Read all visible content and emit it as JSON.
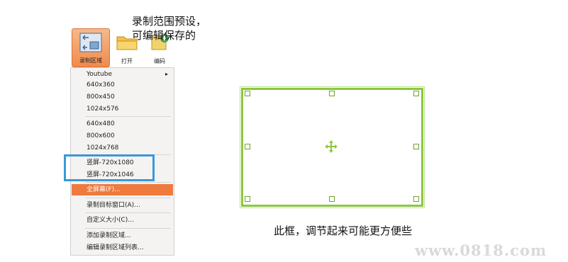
{
  "toolbar": {
    "record_region_label": "录制区域",
    "open_label": "打开",
    "edit_label": "编码"
  },
  "menu": {
    "items": [
      {
        "label": "Youtube"
      },
      {
        "label": "640x360"
      },
      {
        "label": "800x450"
      },
      {
        "label": "1024x576"
      },
      {
        "label": "640x480"
      },
      {
        "label": "800x600"
      },
      {
        "label": "1024x768"
      },
      {
        "label": "竖屏-720x1080"
      },
      {
        "label": "竖屏-720x1046"
      },
      {
        "label": "全屏幕(F)..."
      },
      {
        "label": "录制目标窗口(A)..."
      },
      {
        "label": "自定义大小(C)..."
      },
      {
        "label": "添加录制区域..."
      },
      {
        "label": "编辑录制区域列表..."
      }
    ]
  },
  "annotations": {
    "callout_line1": "录制范围预设，",
    "callout_line2": "可编辑保存的",
    "caption": "此框，调节起来可能更方便些"
  },
  "watermark": "www.0818.com",
  "colors": {
    "accent_orange": "#ee7a3e",
    "highlight_blue": "#3a98d8",
    "frame_green": "#8cc63f"
  }
}
